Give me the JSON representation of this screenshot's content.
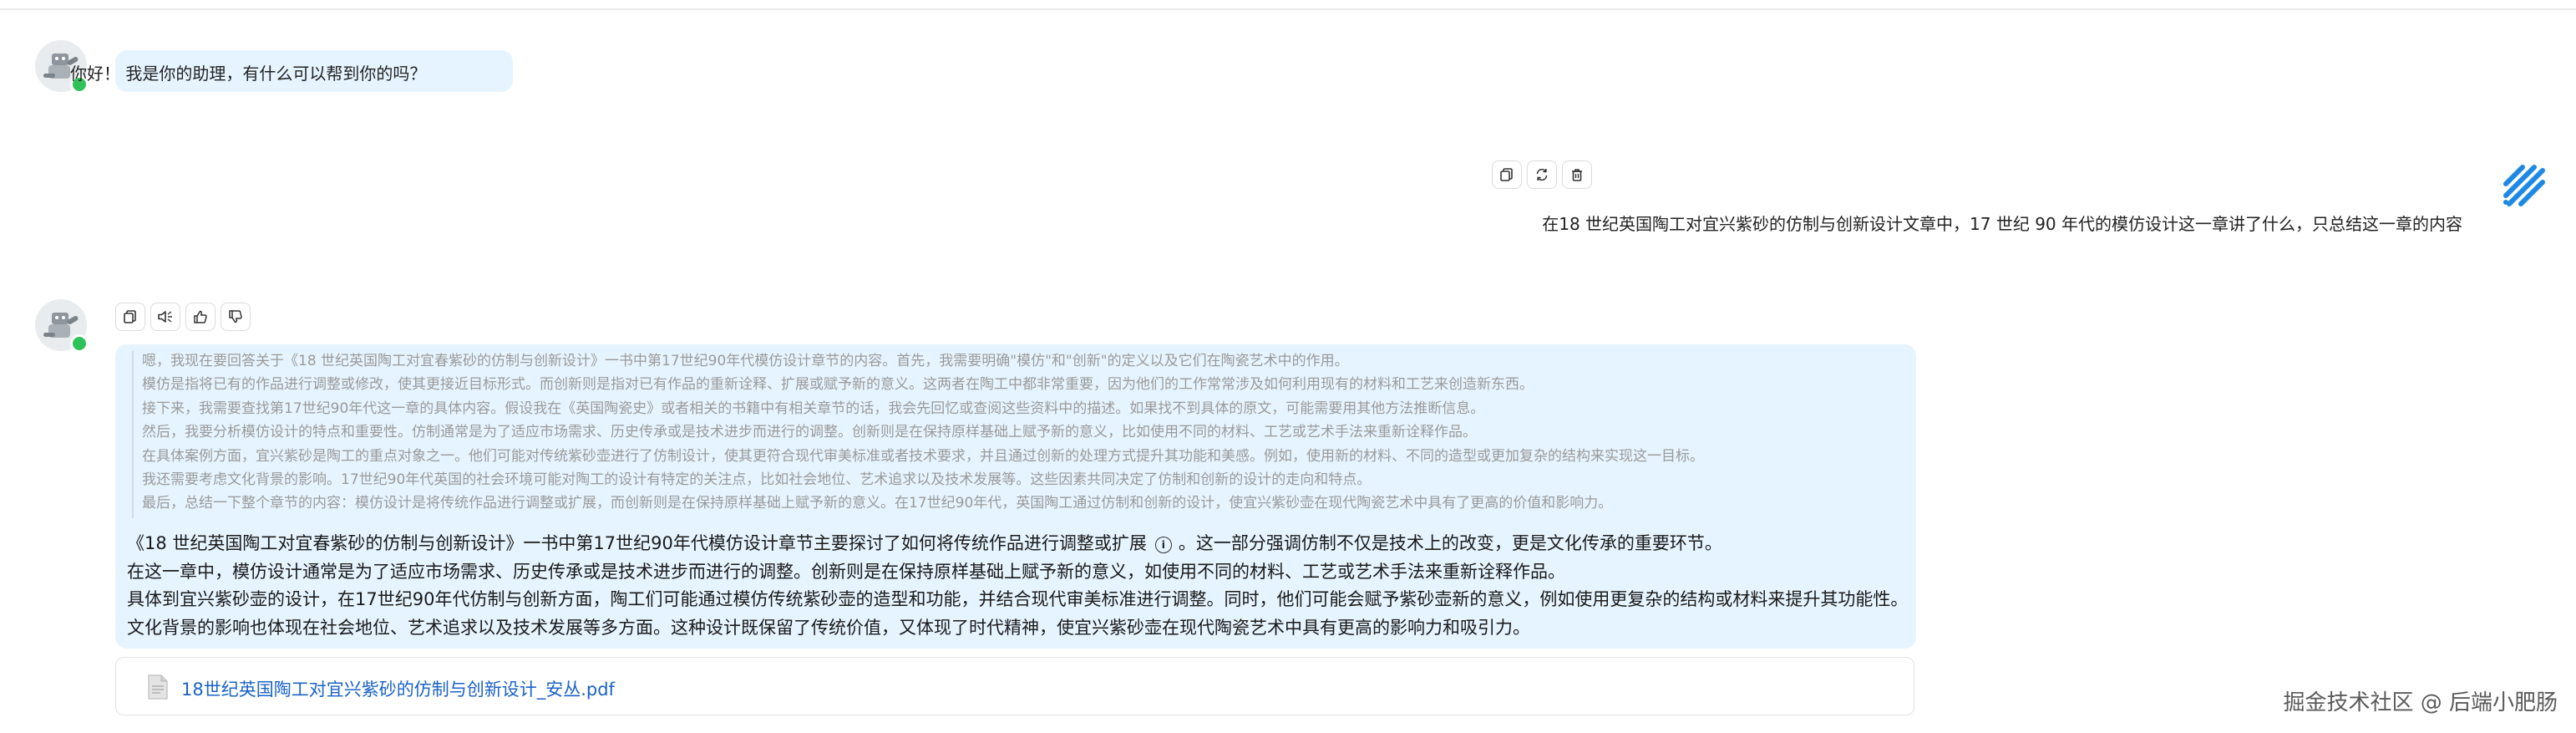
{
  "assistant_greeting": "你好！ 我是你的助理，有什么可以帮到你的吗？",
  "user_message": "在18 世纪英国陶工对宜兴紫砂的仿制与创新设计文章中，17 世纪 90 年代的模仿设计这一章讲了什么，只总结这一章的内容",
  "user_toolbar": {
    "icons": [
      "copy-icon",
      "refresh-icon",
      "delete-icon"
    ]
  },
  "assistant_toolbar": {
    "icons": [
      "copy-icon",
      "speaker-icon",
      "thumbs-up-icon",
      "thumbs-down-icon"
    ]
  },
  "thinking": [
    "嗯，我现在要回答关于《18 世纪英国陶工对宜春紫砂的仿制与创新设计》一书中第17世纪90年代模仿设计章节的内容。首先，我需要明确\"模仿\"和\"创新\"的定义以及它们在陶瓷艺术中的作用。",
    "模仿是指将已有的作品进行调整或修改，使其更接近目标形式。而创新则是指对已有作品的重新诠释、扩展或赋予新的意义。这两者在陶工中都非常重要，因为他们的工作常常涉及如何利用现有的材料和工艺来创造新东西。",
    "接下来，我需要查找第17世纪90年代这一章的具体内容。假设我在《英国陶瓷史》或者相关的书籍中有相关章节的话，我会先回忆或查阅这些资料中的描述。如果找不到具体的原文，可能需要用其他方法推断信息。",
    "然后，我要分析模仿设计的特点和重要性。仿制通常是为了适应市场需求、历史传承或是技术进步而进行的调整。创新则是在保持原样基础上赋予新的意义，比如使用不同的材料、工艺或艺术手法来重新诠释作品。",
    "在具体案例方面，宜兴紫砂是陶工的重点对象之一。他们可能对传统紫砂壶进行了仿制设计，使其更符合现代审美标准或者技术要求，并且通过创新的处理方式提升其功能和美感。例如，使用新的材料、不同的造型或更加复杂的结构来实现这一目标。",
    "我还需要考虑文化背景的影响。17世纪90年代英国的社会环境可能对陶工的设计有特定的关注点，比如社会地位、艺术追求以及技术发展等。这些因素共同决定了仿制和创新的设计的走向和特点。",
    "最后，总结一下整个章节的内容：模仿设计是将传统作品进行调整或扩展，而创新则是在保持原样基础上赋予新的意义。在17世纪90年代，英国陶工通过仿制和创新的设计，使宜兴紫砂壶在现代陶瓷艺术中具有了更高的价值和影响力。"
  ],
  "answer": {
    "line1_before": "《18 世纪英国陶工对宜春紫砂的仿制与创新设计》一书中第17世纪90年代模仿设计章节主要探讨了如何将传统作品进行调整或扩展",
    "info_glyph": "i",
    "line1_after": "。这一部分强调仿制不仅是技术上的改变，更是文化传承的重要环节。",
    "line2": "在这一章中，模仿设计通常是为了适应市场需求、历史传承或是技术进步而进行的调整。创新则是在保持原样基础上赋予新的意义，如使用不同的材料、工艺或艺术手法来重新诠释作品。",
    "line3": "具体到宜兴紫砂壶的设计，在17世纪90年代仿制与创新方面，陶工们可能通过模仿传统紫砂壶的造型和功能，并结合现代审美标准进行调整。同时，他们可能会赋予紫砂壶新的意义，例如使用更复杂的结构或材料来提升其功能性。",
    "line4": "文化背景的影响也体现在社会地位、艺术追求以及技术发展等多方面。这种设计既保留了传统价值，又体现了时代精神，使宜兴紫砂壶在现代陶瓷艺术中具有更高的影响力和吸引力。"
  },
  "file": {
    "name": "18世纪英国陶工对宜兴紫砂的仿制与创新设计_安丛.pdf",
    "icon": "document-icon"
  },
  "watermark": "掘金技术社区 @ 后端小肥肠",
  "colors": {
    "bubble": "#e6f4ff",
    "online": "#2fc25b",
    "link": "#1a63c7",
    "brand": "#1e88e5"
  }
}
